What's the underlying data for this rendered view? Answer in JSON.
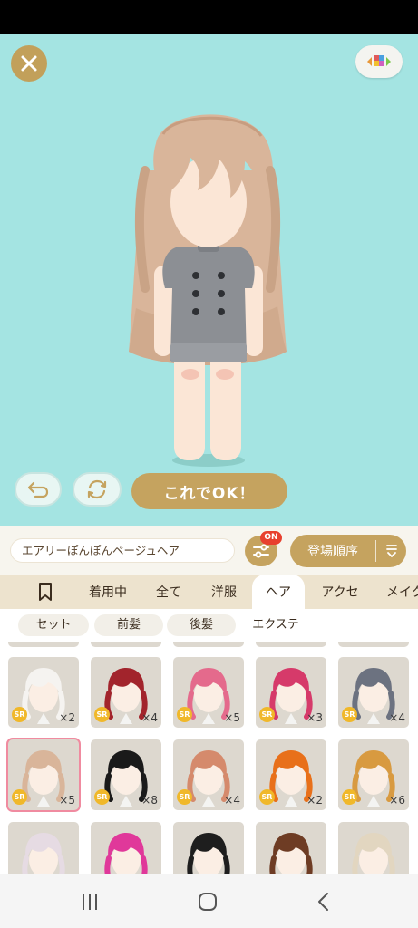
{
  "header": {
    "ok_label": "これでOK！"
  },
  "toolbar": {
    "item_name": "エアリーぽんぽんベージュヘア",
    "filter_badge": "ON",
    "sort_label": "登場順序"
  },
  "tabs": [
    {
      "label": "着用中"
    },
    {
      "label": "全て"
    },
    {
      "label": "洋服"
    },
    {
      "label": "ヘア",
      "active": true
    },
    {
      "label": "アクセ"
    },
    {
      "label": "メイク"
    }
  ],
  "subtabs": [
    {
      "label": "セット"
    },
    {
      "label": "前髪"
    },
    {
      "label": "後髪"
    },
    {
      "label": "エクステ"
    }
  ],
  "grid": {
    "rarity": "SR",
    "row1": [
      {
        "hair": "#f5f3f0",
        "count": "×2"
      },
      {
        "hair": "#a2242c",
        "count": "×4"
      },
      {
        "hair": "#e46a8c",
        "count": "×5"
      },
      {
        "hair": "#d63a6a",
        "count": "×3"
      },
      {
        "hair": "#6c7280",
        "count": "×4"
      }
    ],
    "row2": [
      {
        "hair": "#d9b59a",
        "count": "×5",
        "selected": true
      },
      {
        "hair": "#1a1a1a",
        "count": "×8"
      },
      {
        "hair": "#d58a6c",
        "count": "×4"
      },
      {
        "hair": "#e8701a",
        "count": "×2"
      },
      {
        "hair": "#d89a40",
        "count": "×6"
      }
    ],
    "row3": [
      {
        "hair": "#e6dbe3"
      },
      {
        "hair": "#e0389a"
      },
      {
        "hair": "#1e1e1e"
      },
      {
        "hair": "#6e3c24"
      },
      {
        "hair": "#e2d6c0"
      }
    ]
  },
  "colors": {
    "stage_bg": "#a4e4e2",
    "gold": "#c5a35f",
    "badge_red": "#e8402e",
    "selected_border": "#f08ba0"
  },
  "icons": [
    "close-icon",
    "palette-icon",
    "undo-icon",
    "refresh-icon",
    "filter-sliders-icon",
    "sort-icon",
    "bookmark-icon",
    "recents-icon",
    "home-icon",
    "back-icon"
  ]
}
